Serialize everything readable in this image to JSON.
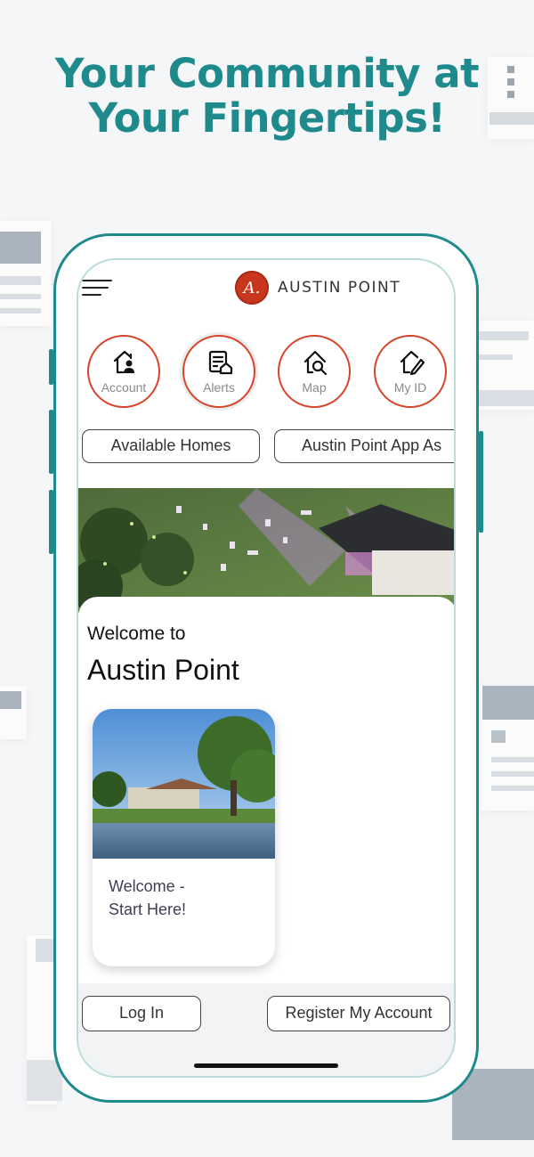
{
  "headline": {
    "line1": "Your Community at",
    "line2": "Your Fingertips!"
  },
  "app": {
    "brand": "AUSTIN POINT",
    "brand_color": "#c8361e",
    "accent_color": "#1f8a8c",
    "menu_icon": "hamburger-icon",
    "quick_actions": [
      {
        "label": "Account",
        "icon": "account-house-icon"
      },
      {
        "label": "Alerts",
        "icon": "alerts-icon"
      },
      {
        "label": "Map",
        "icon": "map-search-icon"
      },
      {
        "label": "My ID",
        "icon": "id-edit-icon"
      }
    ],
    "pills": [
      "Available Homes",
      "Austin Point App As"
    ],
    "welcome_line1": "Welcome to",
    "welcome_line2": "Austin Point",
    "card": {
      "title_line1": "Welcome -",
      "title_line2": "Start Here!"
    },
    "login_label": "Log In",
    "register_label": "Register My Account"
  }
}
